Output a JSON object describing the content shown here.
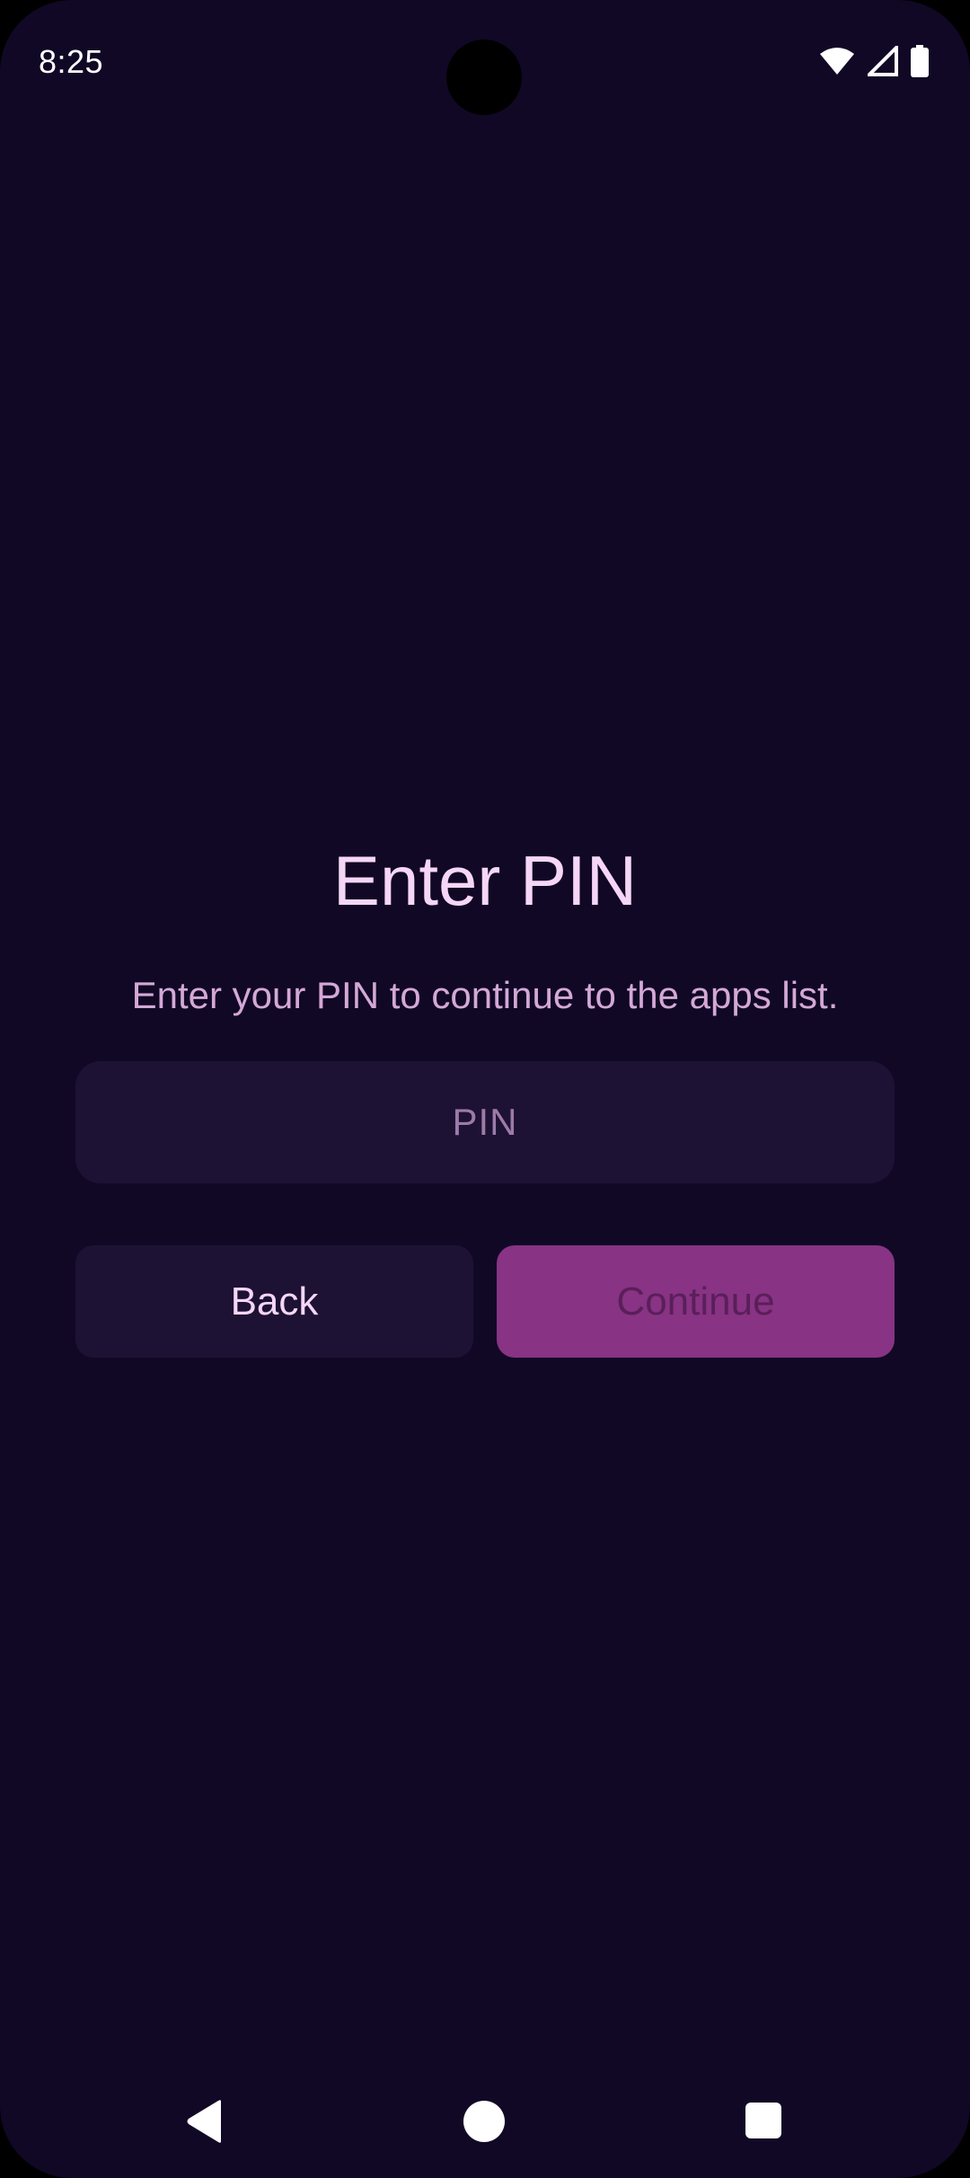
{
  "status_bar": {
    "time": "8:25",
    "icons": [
      "wifi-icon",
      "signal-icon",
      "battery-icon"
    ]
  },
  "screen": {
    "title": "Enter PIN",
    "subtitle": "Enter your PIN to continue to the apps list.",
    "pin_field": {
      "placeholder": "PIN",
      "value": ""
    },
    "buttons": {
      "back_label": "Back",
      "continue_label": "Continue",
      "continue_enabled": false
    }
  },
  "nav_bar": {
    "icons": [
      "nav-back-icon",
      "nav-home-icon",
      "nav-recents-icon"
    ]
  },
  "colors": {
    "background": "#110826",
    "surface": "#1d1233",
    "accent": "#883384",
    "title_text": "#f6d6f7",
    "subtitle_text": "#d4a8d6",
    "placeholder_text": "#9d7aa9",
    "disabled_button_text": "#5a1f59"
  }
}
